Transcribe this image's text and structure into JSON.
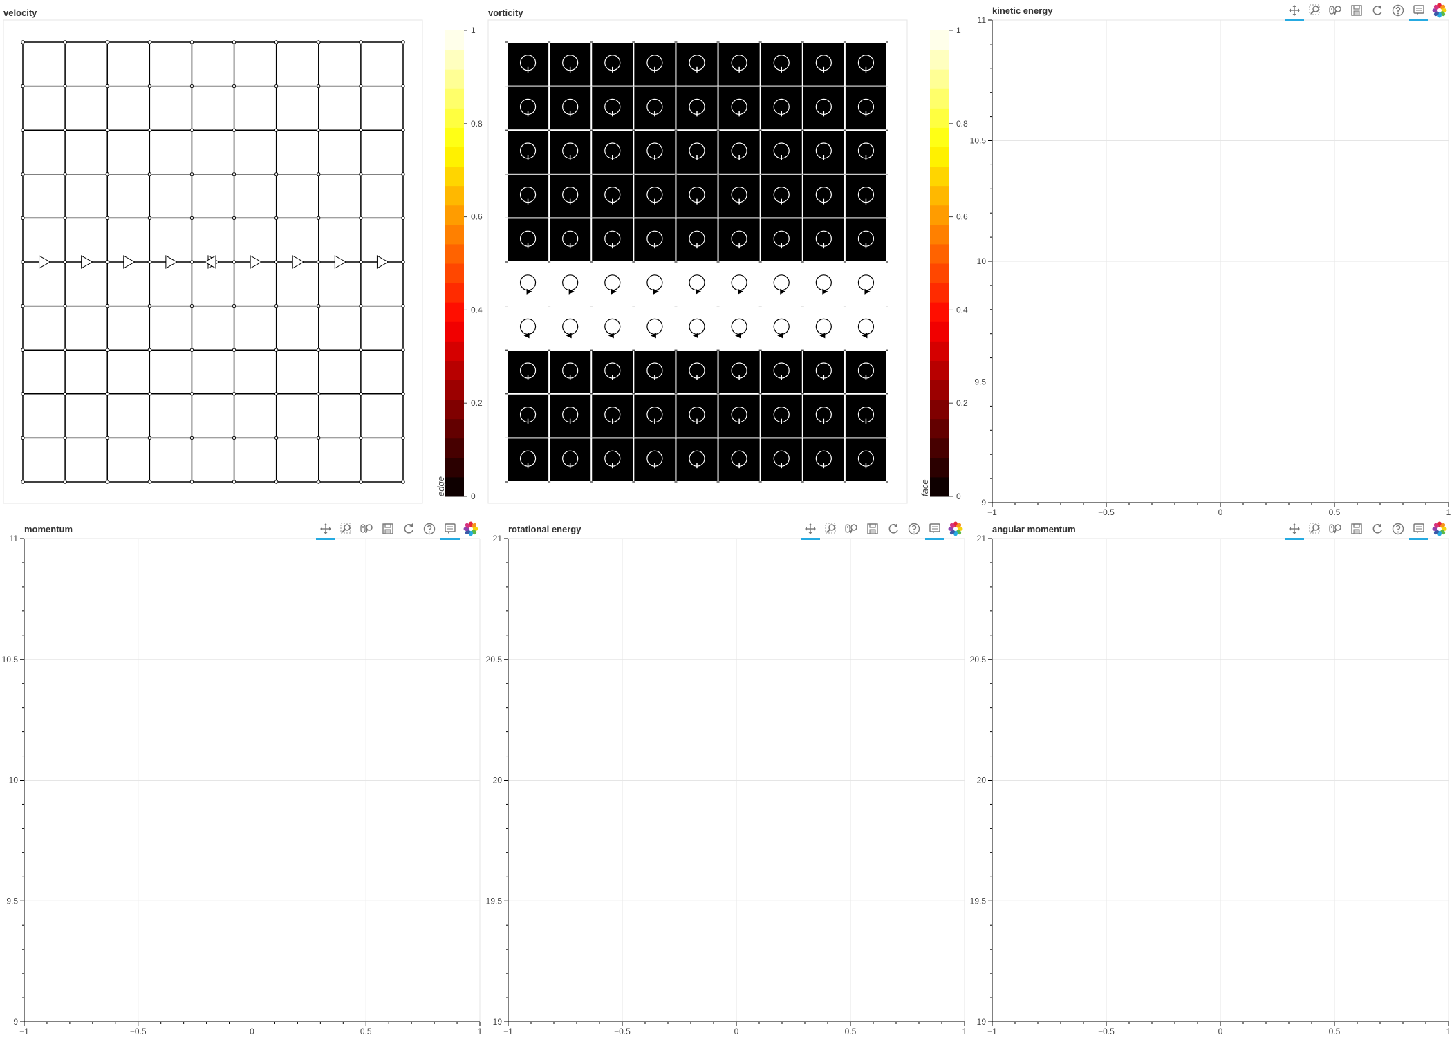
{
  "panels": {
    "velocity": {
      "title": "velocity"
    },
    "vorticity": {
      "title": "vorticity"
    },
    "kinetic_energy": {
      "title": "kinetic energy"
    },
    "momentum": {
      "title": "momentum"
    },
    "rotational_energy": {
      "title": "rotational energy"
    },
    "angular_momentum": {
      "title": "angular momentum"
    }
  },
  "colorbars": {
    "edge": {
      "label": "edge",
      "ticks": [
        "0",
        "0.2",
        "0.4",
        "0.6",
        "0.8",
        "1"
      ]
    },
    "face": {
      "label": "face",
      "ticks": [
        "0",
        "0.2",
        "0.4",
        "0.6",
        "0.8",
        "1"
      ]
    }
  },
  "toolbar": {
    "tools": [
      "pan-icon",
      "box-zoom-icon",
      "wheel-zoom-icon",
      "save-icon",
      "reset-icon",
      "help-icon",
      "hover-icon",
      "bokeh-logo-icon"
    ],
    "active_color": "#26aae1"
  },
  "grid": {
    "cols": 9,
    "rows": 10,
    "arrow_row": "middle",
    "flow_direction": "right",
    "vorticity_light_rows": [
      5,
      6
    ]
  },
  "chart_data": [
    {
      "name": "kinetic energy",
      "type": "line",
      "series": [],
      "xlim": [
        -1,
        1
      ],
      "ylim": [
        9,
        11
      ],
      "xticks": [
        "−1",
        "−0.5",
        "0",
        "0.5",
        "1"
      ],
      "yticks": [
        "9",
        "9.5",
        "10",
        "10.5",
        "11"
      ],
      "grid": true
    },
    {
      "name": "momentum",
      "type": "line",
      "series": [],
      "xlim": [
        -1,
        1
      ],
      "ylim": [
        9,
        11
      ],
      "xticks": [
        "−1",
        "−0.5",
        "0",
        "0.5",
        "1"
      ],
      "yticks": [
        "9",
        "9.5",
        "10",
        "10.5",
        "11"
      ],
      "grid": true
    },
    {
      "name": "rotational energy",
      "type": "line",
      "series": [],
      "xlim": [
        -1,
        1
      ],
      "ylim": [
        19,
        21
      ],
      "xticks": [
        "−1",
        "−0.5",
        "0",
        "0.5",
        "1"
      ],
      "yticks": [
        "19",
        "19.5",
        "20",
        "20.5",
        "21"
      ],
      "grid": true
    },
    {
      "name": "angular momentum",
      "type": "line",
      "series": [],
      "xlim": [
        -1,
        1
      ],
      "ylim": [
        19,
        21
      ],
      "xticks": [
        "−1",
        "−0.5",
        "0",
        "0.5",
        "1"
      ],
      "yticks": [
        "19",
        "19.5",
        "20",
        "20.5",
        "21"
      ],
      "grid": true
    }
  ]
}
